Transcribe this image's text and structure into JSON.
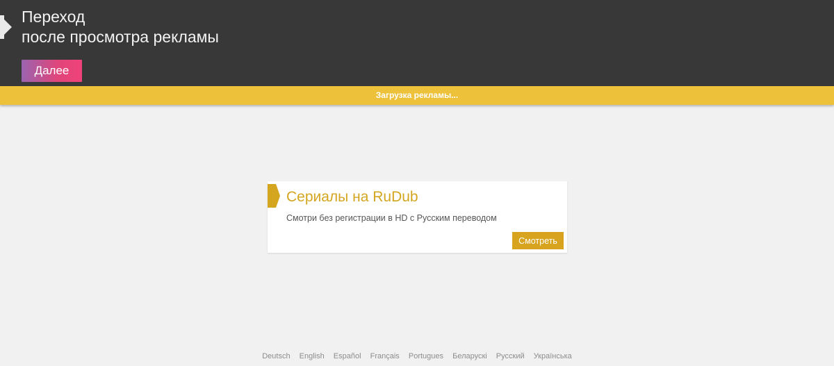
{
  "header": {
    "title_line1": "Переход",
    "title_line2": "после просмотра рекламы",
    "next_button_label": "Далее"
  },
  "loading": {
    "text": "Загрузка рекламы..."
  },
  "ad": {
    "title": "Сериалы на RuDub",
    "description": "Смотри без регистрации в HD с Русским переводом",
    "button_label": "Смотреть"
  },
  "footer": {
    "languages": [
      "Deutsch",
      "English",
      "Español",
      "Français",
      "Portugues",
      "Беларускі",
      "Русский",
      "Українська"
    ]
  },
  "colors": {
    "header_bg": "#383838",
    "loading_bar": "#edc13a",
    "ad_accent": "#d4a51f",
    "button_gradient_start": "#9b63b0",
    "button_gradient_end": "#f0427a"
  }
}
